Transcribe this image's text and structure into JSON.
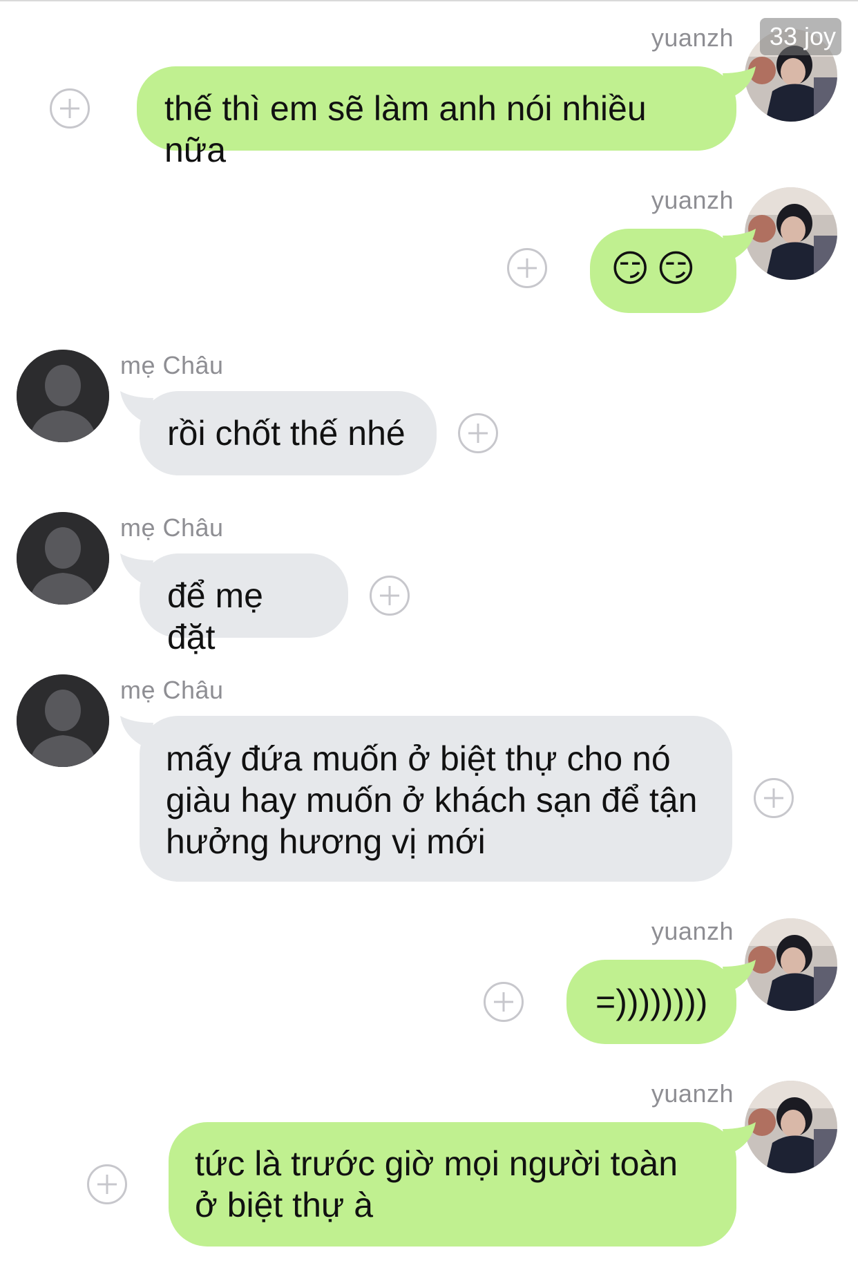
{
  "watermark": "33 joy",
  "messages": [
    {
      "sender": "yuanzh",
      "side": "right",
      "text": "thế thì em sẽ làm anh nói nhiều nữa"
    },
    {
      "sender": "yuanzh",
      "side": "right",
      "text": "😏😏"
    },
    {
      "sender": "mẹ Châu",
      "side": "left",
      "text": "rồi chốt thế nhé"
    },
    {
      "sender": "mẹ Châu",
      "side": "left",
      "text": "để mẹ đặt"
    },
    {
      "sender": "mẹ Châu",
      "side": "left",
      "text": "mấy đứa muốn ở biệt thự cho nó giàu hay muốn ở khách sạn để tận hưởng hương vị mới"
    },
    {
      "sender": "yuanzh",
      "side": "right",
      "text": "=))))))))"
    },
    {
      "sender": "yuanzh",
      "side": "right",
      "text": "tức là trước giờ mọi người toàn ở biệt thự à"
    }
  ],
  "colors": {
    "outgoing_bubble": "#c0f090",
    "incoming_bubble": "#e6e8eb",
    "sender_name": "#8e8e93"
  },
  "icons": {
    "add": "plus-circle-icon",
    "default_avatar": "person-silhouette-icon"
  }
}
